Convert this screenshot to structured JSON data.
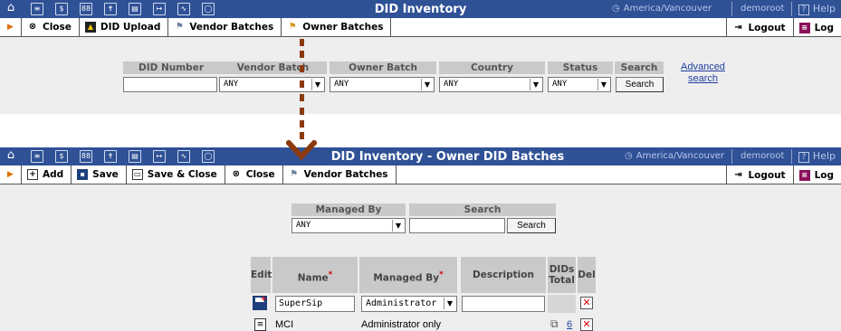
{
  "top_panel": {
    "nav_icons": [
      "home-icon",
      "list-icon",
      "dollar-icon",
      "grid-icon",
      "person-icon",
      "calendar-icon",
      "export-icon",
      "chart-icon",
      "search-icon"
    ],
    "title": "DID Inventory",
    "timezone": "America/Vancouver",
    "user": "demoroot",
    "help": "Help",
    "toolbar": {
      "close": "Close",
      "did_upload": "DID Upload",
      "vendor_batches": "Vendor Batches",
      "owner_batches": "Owner Batches",
      "logout": "Logout",
      "log": "Log"
    },
    "search_form": {
      "headers": {
        "did_number": "DID Number",
        "vendor_batch": "Vendor Batch",
        "owner_batch": "Owner Batch",
        "country": "Country",
        "status": "Status",
        "search": "Search"
      },
      "did_number_value": "",
      "vendor_batch_value": "ANY",
      "owner_batch_value": "ANY",
      "country_value": "ANY",
      "status_value": "ANY",
      "search_button": "Search",
      "advanced_search_line1": "Advanced",
      "advanced_search_line2": "search"
    }
  },
  "bottom_panel": {
    "title": "DID Inventory - Owner DID Batches",
    "timezone": "America/Vancouver",
    "user": "demoroot",
    "help": "Help",
    "toolbar": {
      "add": "Add",
      "save": "Save",
      "save_close": "Save & Close",
      "close": "Close",
      "vendor_batches": "Vendor Batches",
      "logout": "Logout",
      "log": "Log"
    },
    "filter": {
      "managed_by_header": "Managed By",
      "search_header": "Search",
      "managed_by_value": "ANY",
      "search_value": "",
      "search_button": "Search"
    },
    "table": {
      "headers": {
        "edit": "Edit",
        "name": "Name",
        "name_req": "*",
        "managed_by": "Managed By",
        "managed_by_req": "*",
        "description": "Description",
        "dids_total_line1": "DIDs",
        "dids_total_line2": "Total",
        "del": "Del"
      },
      "edit_row": {
        "name_value": "SuperSip",
        "managed_by_value": "Administrator",
        "description_value": ""
      },
      "rows": [
        {
          "name": "MCI",
          "managed_by": "Administrator only",
          "description": "",
          "dids_total": "6"
        }
      ]
    }
  },
  "colors": {
    "titlebar": "#2f5196",
    "accent_arrow": "#8b3a0f",
    "header_gray": "#c9c9c9",
    "content_bg": "#eeeeee",
    "delete_red": "#d40000"
  }
}
